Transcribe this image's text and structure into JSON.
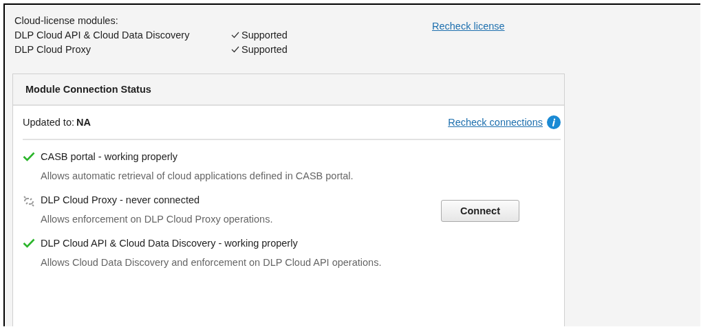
{
  "license": {
    "heading": "Cloud-license modules:",
    "recheck_link": "Recheck license",
    "modules": [
      {
        "name": "DLP Cloud API & Cloud Data Discovery",
        "status": "Supported",
        "supported": true
      },
      {
        "name": "DLP Cloud Proxy",
        "status": "Supported",
        "supported": true
      }
    ]
  },
  "panel": {
    "title": "Module Connection Status",
    "updated_label": "Updated to:",
    "updated_value": "NA",
    "recheck_link": "Recheck connections",
    "connections": [
      {
        "kind": "ok",
        "title": "CASB portal - working properly",
        "description": "Allows automatic retrieval of cloud applications defined in CASB portal."
      },
      {
        "kind": "disconnected",
        "title": "DLP Cloud Proxy - never connected",
        "description": "Allows enforcement on DLP Cloud Proxy operations.",
        "button": "Connect"
      },
      {
        "kind": "ok",
        "title": "DLP Cloud API & Cloud Data Discovery - working properly",
        "description": "Allows Cloud Data Discovery and enforcement on DLP Cloud API operations."
      }
    ]
  }
}
